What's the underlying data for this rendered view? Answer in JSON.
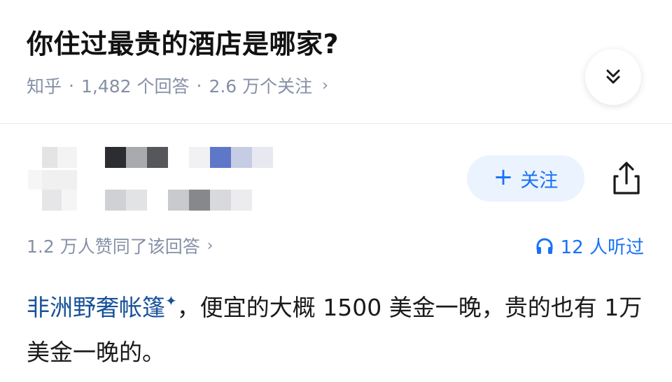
{
  "question": {
    "title": "你住过最贵的酒店是哪家?",
    "source": "知乎",
    "answers": "1,482 个回答",
    "followers": "2.6 万个关注",
    "separator": "·",
    "chevron": "›"
  },
  "icons": {
    "collapse": "double-chevron-down-icon",
    "share": "share-icon",
    "headphones": "headphones-icon",
    "plus": "plus-icon"
  },
  "author": {
    "follow_plus": "+",
    "follow_label": "关注"
  },
  "stats": {
    "agree_text": "1.2 万人赞同了该回答",
    "chevron": "›",
    "listen_text": "12 人听过"
  },
  "answer": {
    "link_text": "非洲野奢帐篷",
    "spark": "✦",
    "body_text": "，便宜的大概 1500 美金一晚，贵的也有 1万美金一晚的。"
  },
  "colors": {
    "accent": "#1772f6",
    "link": "#175199",
    "meta": "#8590a6",
    "follow_bg": "#ebf3ff"
  }
}
